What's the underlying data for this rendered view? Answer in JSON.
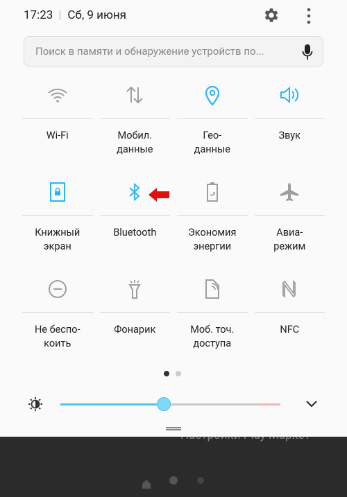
{
  "status": {
    "time": "17:23",
    "date": "Сб, 9 июня"
  },
  "search": {
    "placeholder": "Поиск в памяти и обнаружение устройств по..."
  },
  "tiles": [
    {
      "label1": "Wi-Fi",
      "label2": "",
      "icon": "wifi-icon",
      "active": false
    },
    {
      "label1": "Мобил.",
      "label2": "данные",
      "icon": "mobile-data-icon",
      "active": false
    },
    {
      "label1": "Гео-",
      "label2": "данные",
      "icon": "location-icon",
      "active": true
    },
    {
      "label1": "Звук",
      "label2": "",
      "icon": "sound-icon",
      "active": true
    },
    {
      "label1": "Книжный",
      "label2": "экран",
      "icon": "portrait-lock-icon",
      "active": true
    },
    {
      "label1": "Bluetooth",
      "label2": "",
      "icon": "bluetooth-icon",
      "active": true
    },
    {
      "label1": "Экономия",
      "label2": "энергии",
      "icon": "power-saving-icon",
      "active": false
    },
    {
      "label1": "Авиа-",
      "label2": "режим",
      "icon": "airplane-icon",
      "active": false
    },
    {
      "label1": "Не беспо-",
      "label2": "коить",
      "icon": "do-not-disturb-icon",
      "active": false
    },
    {
      "label1": "Фонарик",
      "label2": "",
      "icon": "flashlight-icon",
      "active": false
    },
    {
      "label1": "Моб. точ.",
      "label2": "доступа",
      "icon": "hotspot-icon",
      "active": false
    },
    {
      "label1": "NFC",
      "label2": "",
      "icon": "nfc-icon",
      "active": false
    }
  ],
  "pages": {
    "current": 1,
    "total": 2
  },
  "brightness": {
    "level_percent": 47
  },
  "background_text": "Настройки  Play Маркет",
  "colors": {
    "accent": "#29b6f6",
    "inactive": "#9e9e9e",
    "arrow": "#e01010",
    "panel": "#fafafa",
    "background": "#2b2b2b"
  }
}
